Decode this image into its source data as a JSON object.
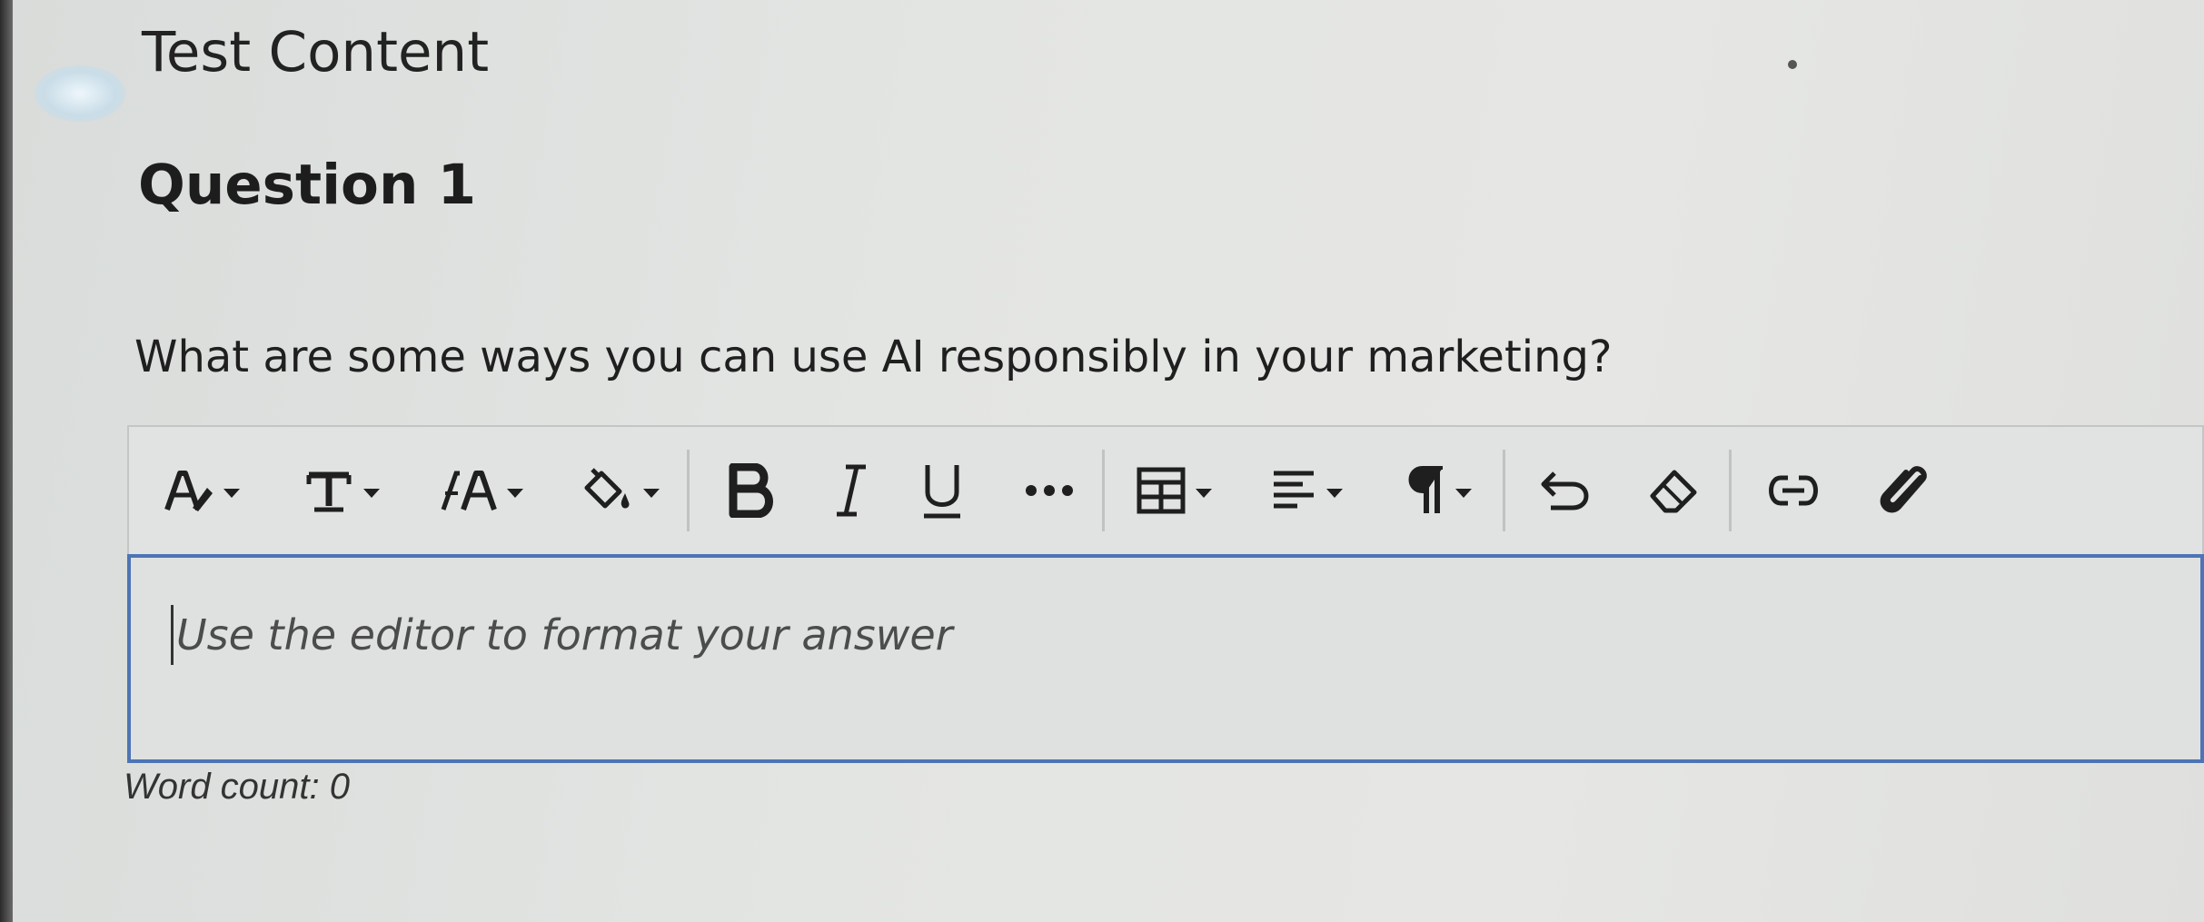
{
  "page": {
    "header": "Test Content"
  },
  "question": {
    "title": "Question 1",
    "prompt": "What are some ways you can use AI responsibly in your marketing?"
  },
  "editor": {
    "placeholder": "Use the editor to format your answer",
    "toolbar": [
      {
        "icon": "font-style-icon",
        "dropdown": true
      },
      {
        "icon": "text-format-icon",
        "dropdown": true
      },
      {
        "icon": "font-size-icon",
        "dropdown": true
      },
      {
        "icon": "fill-color-icon",
        "dropdown": true
      },
      {
        "icon": "bold-icon",
        "dropdown": false
      },
      {
        "icon": "italic-icon",
        "dropdown": false
      },
      {
        "icon": "underline-icon",
        "dropdown": false
      },
      {
        "icon": "more-icon",
        "dropdown": false
      },
      {
        "icon": "table-icon",
        "dropdown": true
      },
      {
        "icon": "align-icon",
        "dropdown": true
      },
      {
        "icon": "paragraph-icon",
        "dropdown": true
      },
      {
        "icon": "undo-icon",
        "dropdown": false
      },
      {
        "icon": "eraser-icon",
        "dropdown": false
      },
      {
        "icon": "link-icon",
        "dropdown": false
      },
      {
        "icon": "attach-icon",
        "dropdown": false
      }
    ],
    "border_color": "#4d74b5"
  },
  "word_count": {
    "label": "Word count:",
    "value": "0"
  }
}
